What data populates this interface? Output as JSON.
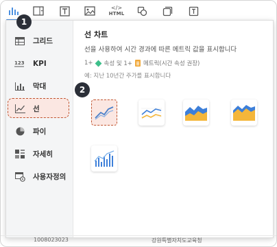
{
  "toolbar": {
    "icons": [
      "bar-chart-icon",
      "dropdown-box-icon",
      "text-icon",
      "image-icon",
      "html-icon",
      "shapes-icon",
      "copy-icon",
      "info-text-icon"
    ],
    "html_label": "HTML"
  },
  "sidebar": {
    "items": [
      {
        "label": "그리드",
        "icon": "grid-icon"
      },
      {
        "label": "KPI",
        "icon": "kpi-icon"
      },
      {
        "label": "막대",
        "icon": "bar-icon"
      },
      {
        "label": "선",
        "icon": "line-icon",
        "active": true
      },
      {
        "label": "파이",
        "icon": "pie-icon"
      },
      {
        "label": "자세히",
        "icon": "detail-icon"
      },
      {
        "label": "사용자정의",
        "icon": "custom-icon"
      }
    ]
  },
  "content": {
    "title": "선 차트",
    "description": "선을 사용하여 시간 경과에 따른 메트릭 값을 표시합니다",
    "req_prefix": "1+",
    "req_attr": "속성 및 1+",
    "req_metric": "메트릭(시간 속성 권장)",
    "example": "예: 지난 10년간 주가를 표시합니다",
    "thumbnails": [
      "line-chart-thumb",
      "multi-line-chart-thumb",
      "area-chart-thumb",
      "stacked-area-chart-thumb",
      "line-bar-combo-thumb"
    ]
  },
  "badges": {
    "one": "1",
    "two": "2"
  },
  "background": {
    "row_left": "1008023023",
    "row_right": "강원특별자치도교육청"
  },
  "colors": {
    "accent": "#4a8fe0",
    "highlight_border": "#c0532e",
    "highlight_fill": "#fbe7e2",
    "badge": "#2b2f38",
    "area_blue": "#3d7fd9",
    "area_yellow": "#f4b63a"
  }
}
